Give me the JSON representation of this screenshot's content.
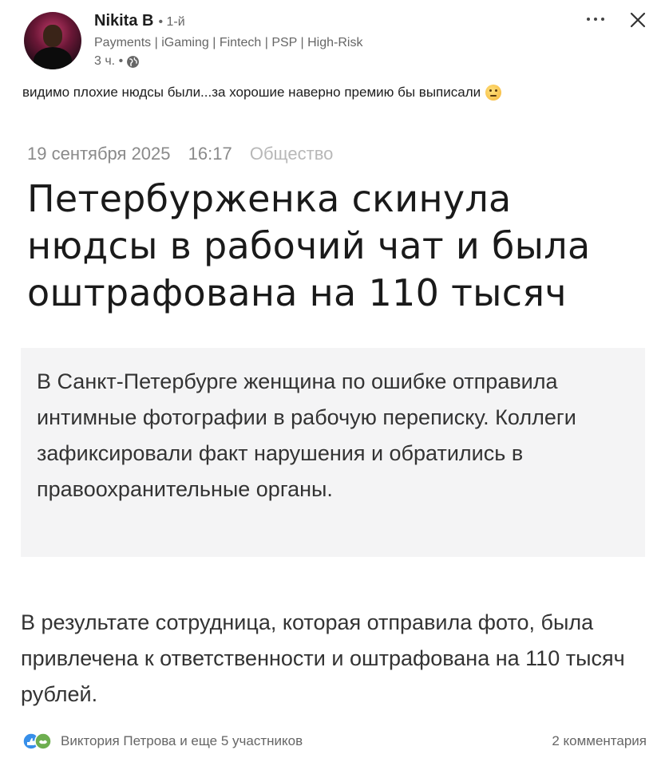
{
  "post": {
    "author": {
      "name": "Nikita B",
      "degree": "• 1-й",
      "headline": "Payments | iGaming | Fintech | PSP | High-Risk",
      "time": "3 ч. •"
    },
    "text": "видимо плохие нюдсы были...за хорошие наверно премию бы выписали",
    "emoji": "thinking-face-icon"
  },
  "article": {
    "date": "19 сентября 2025",
    "time": "16:17",
    "category": "Общество",
    "title": "Петербурженка скинула нюдсы в рабочий чат и была оштрафована на 110 тысяч",
    "lead": "В Санкт-Петербурге женщина по ошибке отправила интимные фотографии в рабочую переписку. Коллеги зафиксировали факт нарушения и обратились в правоохранительные органы.",
    "body": "В результате сотрудница, которая отправила фото, была привлечена к ответственности и оштрафована на 110 тысяч рублей."
  },
  "footer": {
    "reactions": "Виктория Петрова и еще 5 участников",
    "comments": "2 комментария"
  },
  "colors": {
    "reaction_like": "#378fe9",
    "reaction_support": "#6dae4f"
  }
}
